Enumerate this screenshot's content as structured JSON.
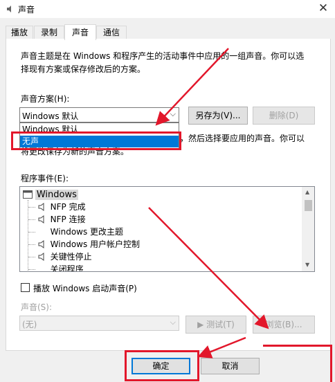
{
  "window": {
    "title": "声音",
    "close_glyph": "✕"
  },
  "tabs": [
    {
      "label": "播放"
    },
    {
      "label": "录制"
    },
    {
      "label": "声音"
    },
    {
      "label": "通信"
    }
  ],
  "sound_tab": {
    "description": "声音主题是在 Windows 和程序产生的活动事件中应用的一组声音。你可以选择现有方案或保存修改后的方案。",
    "scheme_label": "声音方案(H):",
    "scheme_value": "Windows 默认",
    "scheme_options": [
      "Windows 默认",
      "无声"
    ],
    "selected_option": "无声",
    "save_as_button": "另存为(V)...",
    "delete_button": "删除(D)",
    "desc2_part1": "，然后选择要应用的声音。你可以",
    "desc2_part2": "将更改保存为新的声音方案。",
    "events_label": "程序事件(E):",
    "events": [
      {
        "label": "Windows",
        "icon": "windows-folder-icon"
      },
      {
        "label": "NFP 完成",
        "icon": "speaker-icon"
      },
      {
        "label": "NFP 连接",
        "icon": "speaker-icon"
      },
      {
        "label": "Windows 更改主题",
        "icon": ""
      },
      {
        "label": "Windows 用户帐户控制",
        "icon": "speaker-icon"
      },
      {
        "label": "关键性停止",
        "icon": "speaker-icon"
      },
      {
        "label": "关闭程序",
        "icon": ""
      }
    ],
    "startup_checkbox_label": "播放 Windows 启动声音(P)",
    "sounds_label": "声音(S):",
    "sounds_value": "(无)",
    "test_button": "▶ 测试(T)",
    "browse_button": "浏览(B)..."
  },
  "footer": {
    "ok_button": "确定",
    "cancel_button": "取消"
  },
  "colors": {
    "highlight": "#e2172b",
    "selection": "#0078d7"
  }
}
